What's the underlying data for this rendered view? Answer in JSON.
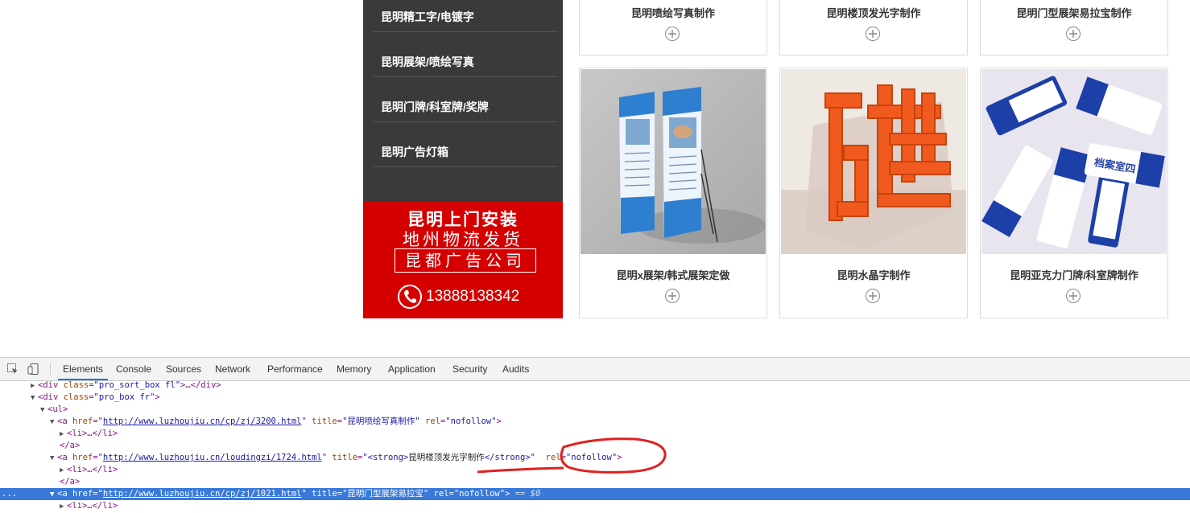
{
  "sidebar": {
    "items": [
      {
        "label": "昆明精工字/电镀字"
      },
      {
        "label": "昆明展架/喷绘写真"
      },
      {
        "label": "昆明门牌/科室牌/奖牌"
      },
      {
        "label": "昆明广告灯箱"
      }
    ]
  },
  "promo": {
    "line1": "昆明上门安装",
    "line2": "地州物流发货",
    "line3": "昆都广告公司",
    "phone": "13888138342",
    "phone_icon": "phone-icon"
  },
  "products": {
    "top_row": [
      {
        "title": "昆明喷绘写真制作"
      },
      {
        "title": "昆明楼顶发光字制作"
      },
      {
        "title": "昆明门型展架易拉宝制作"
      }
    ],
    "bottom_row": [
      {
        "title": "昆明x展架/韩式展架定做"
      },
      {
        "title": "昆明水晶字制作"
      },
      {
        "title": "昆明亚克力门牌/科室牌制作"
      }
    ]
  },
  "devtools": {
    "tabs": [
      "Elements",
      "Console",
      "Sources",
      "Network",
      "Performance",
      "Memory",
      "Application",
      "Security",
      "Audits"
    ],
    "active_tab": "Elements",
    "dom": {
      "l1_open": "<div ",
      "l1_attr": "class",
      "l1_val": "\"pro_sort_box fl\"",
      "l1_close": ">…</div>",
      "l2_open": "<div ",
      "l2_attr": "class",
      "l2_val": "\"pro_box fr\"",
      "l2_close": ">",
      "l3": "<ul>",
      "a_open": "<a ",
      "href_attr": "href",
      "url1": "http://www.luzhoujiu.cn/cp/zj/3200.html",
      "title_attr": "title",
      "title1": "\"昆明喷绘写真制作\"",
      "rel_attr": "rel",
      "rel_val": "\"nofollow\"",
      "li_collapsed": "<li>…</li>",
      "a_close": "</a>",
      "url2": "http://www.luzhoujiu.cn/loudingzi/1724.html",
      "title2_open": "\"<strong>",
      "title2_text": "昆明楼顶发光字制作",
      "title2_close": "</strong>\"",
      "url3": "http://www.luzhoujiu.cn/cp/zj/1021.html",
      "title3": "\"昆明门型展架易拉宝\"",
      "rel_val3": "nofollow",
      "eq0": "== $0",
      "li_partial": "<li>…</li>",
      "dots": "..."
    }
  },
  "colors": {
    "sidebar_bg": "#3a3a3a",
    "promo_red": "#d40000",
    "selection_blue": "#3879d9",
    "annotation_red": "#e02020"
  }
}
